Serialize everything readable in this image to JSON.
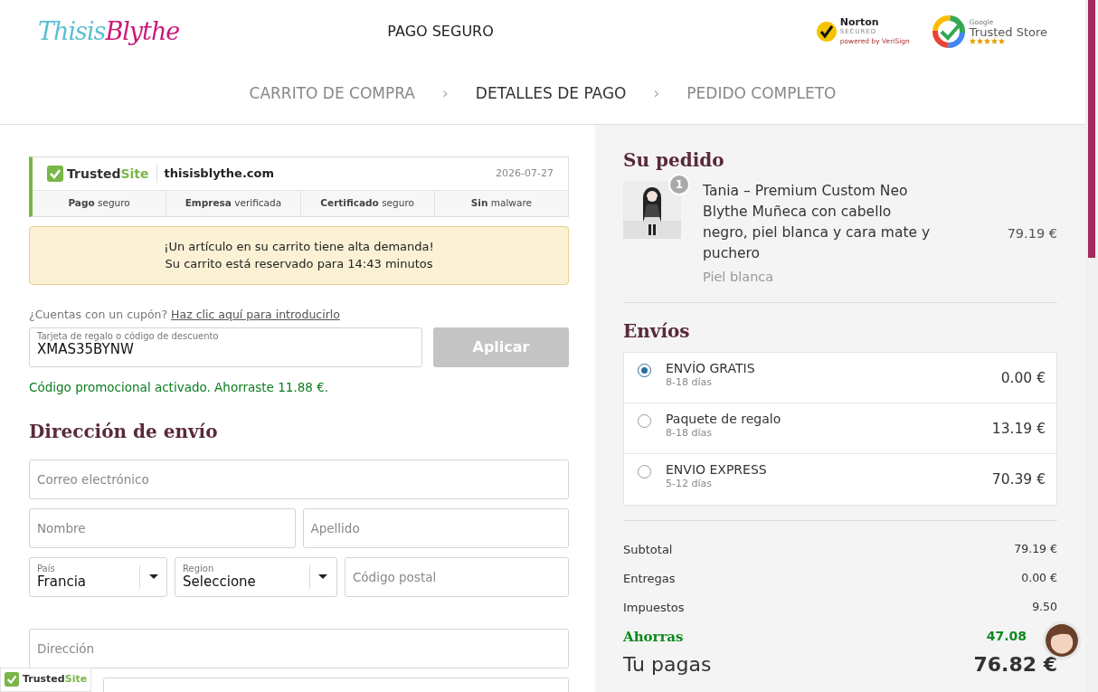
{
  "header": {
    "logo": {
      "first": "Thisis",
      "second": "Blythe"
    },
    "title": "PAGO SEGURO",
    "norton": {
      "name": "Norton",
      "sub": "SECURED",
      "powered": "powered by VeriSign"
    },
    "trusted_store": {
      "small": "Google",
      "name": "Trusted Store",
      "stars": 5
    }
  },
  "steps": [
    {
      "label": "CARRITO DE COMPRA",
      "selected": false
    },
    {
      "label": "DETALLES DE PAGO",
      "selected": true
    },
    {
      "label": "PEDIDO COMPLETO",
      "selected": false
    }
  ],
  "step_separators": [
    "›",
    "›"
  ],
  "trusted_site": {
    "brand_a": "Trusted",
    "brand_b": "Site",
    "domain": "thisisblythe.com",
    "date": "2026-07-27",
    "features": [
      "**Pago** seguro",
      "**Empresa** verificada",
      "**Certificado** seguro",
      "**Sin** malware"
    ]
  },
  "alert": {
    "lines": [
      "¡Un artículo en su carrito tiene alta demanda!",
      "Su carrito está reservado para 14:43 minutos"
    ]
  },
  "coupon": {
    "prompt": "¿Cuentas con un cupón?",
    "link": "Haz clic aquí para introducirlo",
    "field": {
      "label": "Tarjeta de regalo o código de descuento",
      "value": "XMAS35BYNW"
    },
    "button": {
      "label": "Aplicar",
      "disabled": true
    },
    "message": "Código promocional activado. Ahorraste 11.88 €."
  },
  "shipping_address": {
    "title": "Dirección de envío",
    "rows": [
      [
        {
          "kind": "input",
          "placeholder": "Correo electrónico"
        }
      ],
      [
        {
          "kind": "input",
          "placeholder": "Nombre"
        },
        {
          "kind": "input",
          "placeholder": "Apellido"
        }
      ],
      [
        {
          "kind": "select",
          "label": "País",
          "value": "Francia"
        },
        {
          "kind": "select",
          "label": "Region",
          "value": "Seleccione"
        },
        {
          "kind": "input",
          "placeholder": "Código postal"
        }
      ],
      [
        {
          "kind": "input",
          "placeholder": "Dirección"
        }
      ],
      [
        {
          "kind": "input"
        }
      ]
    ]
  },
  "order": {
    "title": "Su pedido",
    "items": [
      {
        "quantity": "1",
        "name": "Tania – Premium Custom Neo Blythe Muñeca con cabello negro, piel blanca y cara mate y puchero",
        "variant": "Piel blanca",
        "price": "79.19 €"
      }
    ],
    "shipping_title": "Envíos",
    "shipping_options": [
      {
        "name": "ENVÍO GRATIS",
        "days": "8-18 días",
        "price": "0.00 €",
        "selected": true
      },
      {
        "name": "Paquete de regalo",
        "days": "8-18 días",
        "price": "13.19 €",
        "selected": false
      },
      {
        "name": "ENVIO EXPRESS",
        "days": "5-12 días",
        "price": "70.39 €",
        "selected": false
      }
    ],
    "totals": [
      {
        "kind": "normal",
        "label": "Subtotal",
        "value": "79.19 €"
      },
      {
        "kind": "normal",
        "label": "Entregas",
        "value": "0.00 €"
      },
      {
        "kind": "normal",
        "label": "Impuestos",
        "value": "9.50"
      },
      {
        "kind": "savings",
        "label": "Ahorras",
        "value": "47.08"
      },
      {
        "kind": "total",
        "label": "Tu pagas",
        "value": "76.82 €"
      }
    ]
  },
  "floating_badge": {
    "brand_a": "Trusted",
    "brand_b": "Site"
  }
}
